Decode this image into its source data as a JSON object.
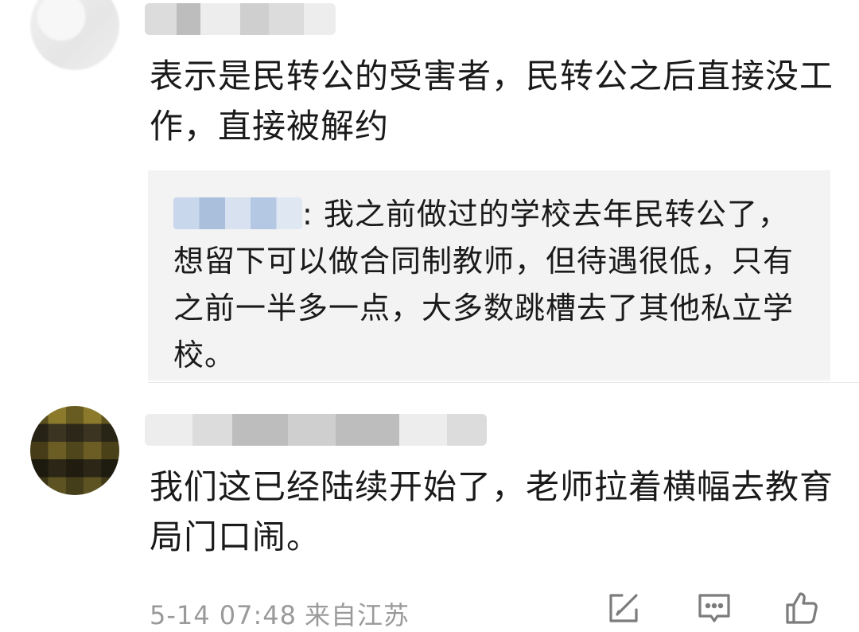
{
  "comments": [
    {
      "main_text": "表示是民转公的受害者，民转公之后直接没工作，直接被解约",
      "quote": {
        "text": ": 我之前做过的学校去年民转公了，想留下可以做合同制教师，但待遇很低，只有之前一半多一点，大多数跳槽去了其他私立学校。"
      }
    },
    {
      "main_text": "我们这已经陆续开始了，老师拉着横幅去教育局门口闹。",
      "time": "5-14 07:48",
      "location": "来自江苏"
    }
  ],
  "icons": [
    "edit-icon",
    "comment-icon",
    "like-icon"
  ]
}
